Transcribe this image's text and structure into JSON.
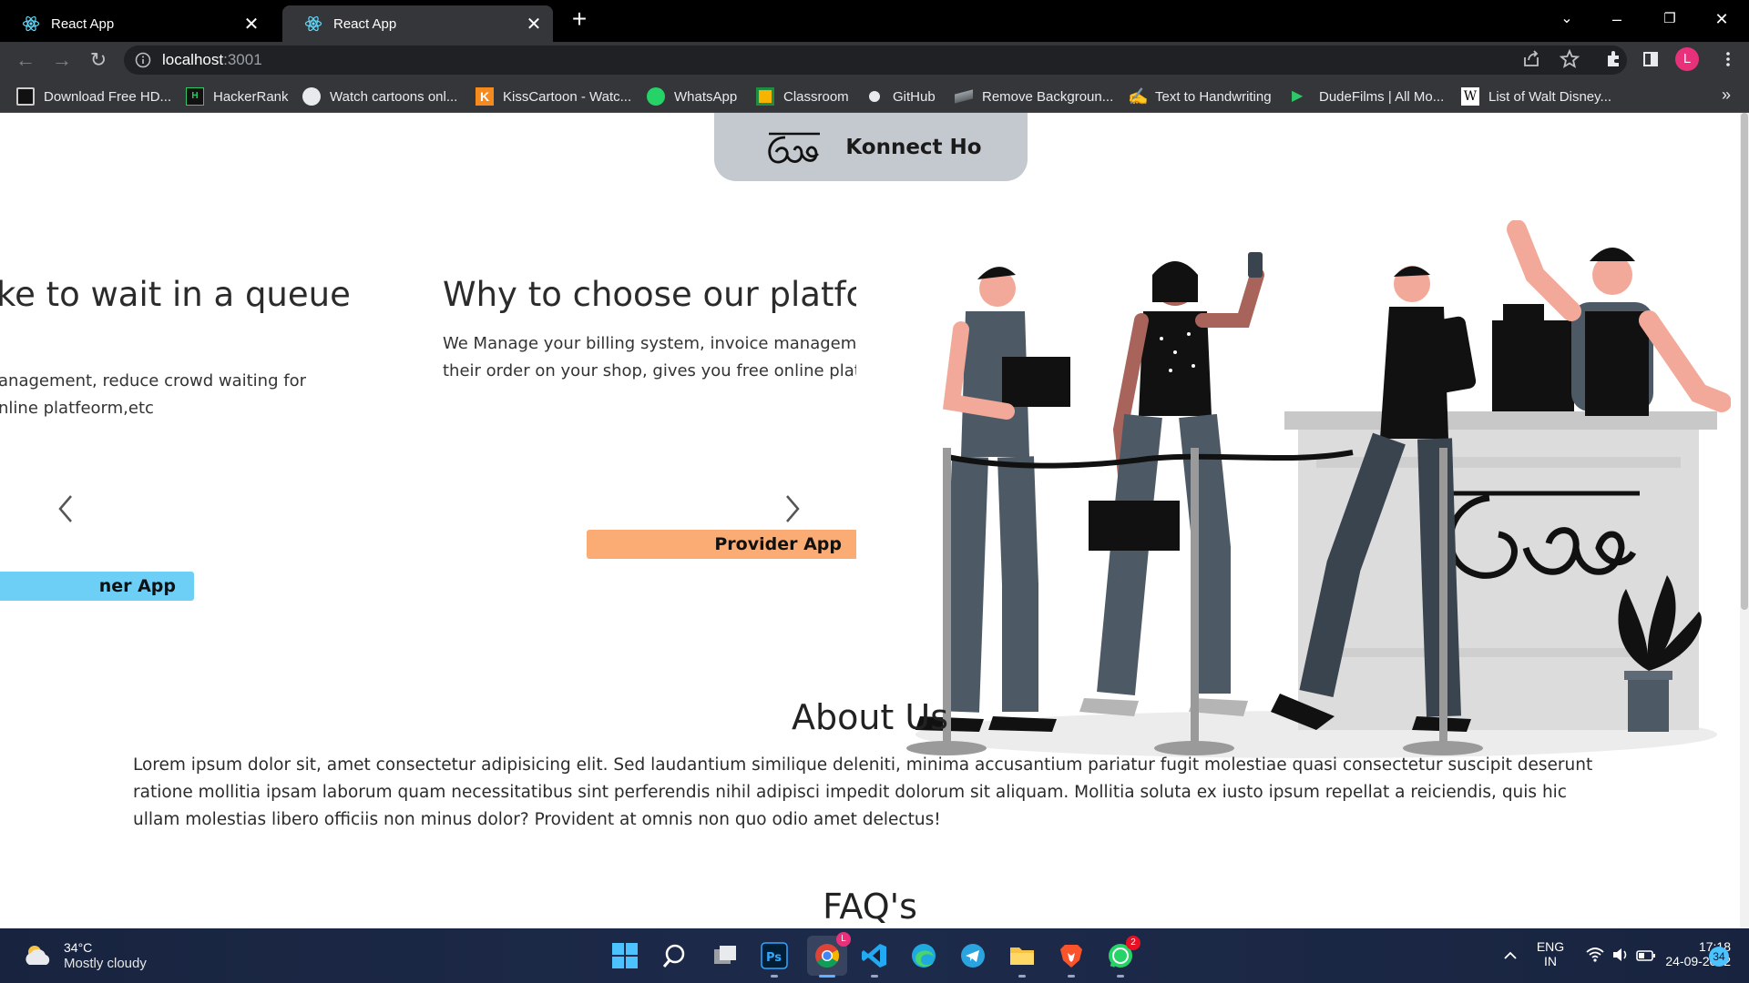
{
  "browser": {
    "tabs": [
      {
        "title": "React App",
        "active": false
      },
      {
        "title": "React App",
        "active": true
      }
    ],
    "address": {
      "host": "localhost",
      "port": ":3001"
    },
    "profile_initial": "L",
    "bookmarks": [
      {
        "label": "Download Free HD...",
        "icon": "download-site-icon"
      },
      {
        "label": "HackerRank",
        "icon": "hackerrank-icon"
      },
      {
        "label": "Watch cartoons onl...",
        "icon": "globe-icon"
      },
      {
        "label": "KissCartoon - Watc...",
        "icon": "kisscartoon-icon"
      },
      {
        "label": "WhatsApp",
        "icon": "whatsapp-icon"
      },
      {
        "label": "Classroom",
        "icon": "classroom-icon"
      },
      {
        "label": "GitHub",
        "icon": "github-icon"
      },
      {
        "label": "Remove Backgroun...",
        "icon": "removebg-icon"
      },
      {
        "label": "Text to Handwriting",
        "icon": "handwriting-icon"
      },
      {
        "label": "DudeFilms | All Mo...",
        "icon": "play-icon"
      },
      {
        "label": "List of Walt Disney...",
        "icon": "wikipedia-icon"
      }
    ]
  },
  "page": {
    "brand": {
      "name": "Konnect Ho"
    },
    "carousel": {
      "slides": [
        {
          "title": "ke to wait in a queue",
          "lines": [
            "anagement, reduce crowd waiting for",
            "nline platfeorm,etc"
          ],
          "button": "ner App",
          "button_color": "#6ecff6"
        },
        {
          "title": "Why to choose our platfc",
          "lines": [
            "We Manage your billing system, invoice manageme",
            "their order on your shop, gives you free online platf"
          ],
          "button": "Provider App",
          "button_color": "#fbac74"
        }
      ]
    },
    "about": {
      "title": "About Us",
      "text": "Lorem ipsum dolor sit, amet consectetur adipisicing elit. Sed laudantium similique deleniti, minima accusantium pariatur fugit molestiae quasi consectetur suscipit deserunt ratione mollitia ipsam laborum quam necessitatibus sint perferendis nihil adipisci impedit dolorum sit aliquam. Mollitia soluta ex iusto ipsum repellat a reiciendis, quis hic ullam molestias libero officiis non minus dolor? Provident at omnis non quo odio amet delectus!"
    },
    "faq": {
      "title": "FAQ's"
    }
  },
  "taskbar": {
    "weather": {
      "temp": "34°C",
      "desc": "Mostly cloudy"
    },
    "chrome_badge": "L",
    "whatsapp_badge": "2",
    "language": {
      "lang": "ENG",
      "region": "IN"
    },
    "clock": {
      "time": "17:18",
      "date": "24-09-2022"
    },
    "notification_count": "34"
  }
}
